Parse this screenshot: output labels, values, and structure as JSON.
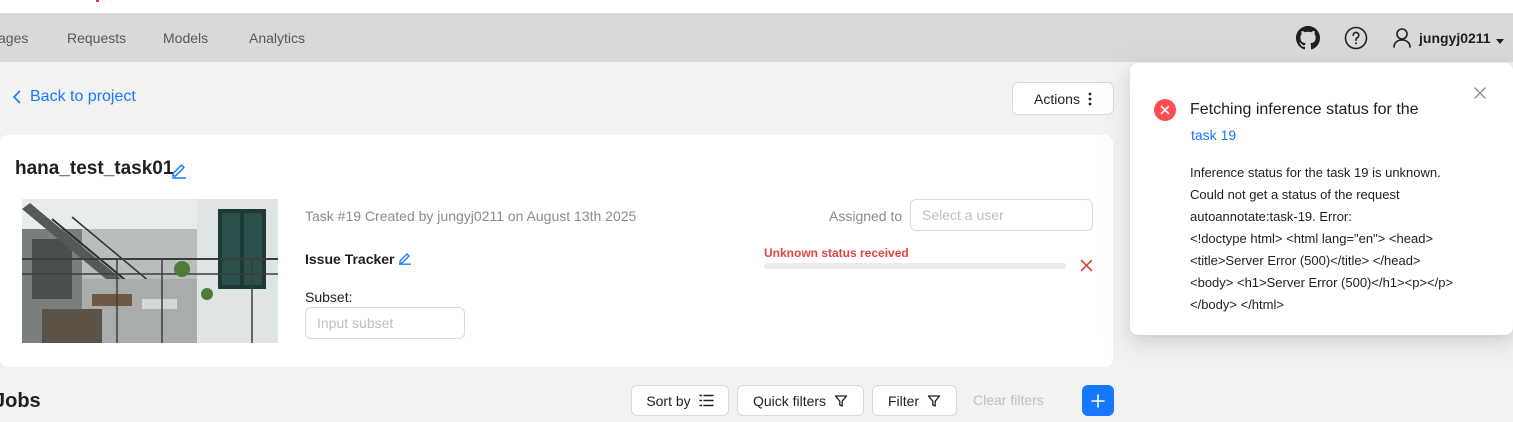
{
  "nav": {
    "items": [
      "ages",
      "Requests",
      "Models",
      "Analytics"
    ],
    "user": "jungyj0211",
    "icons": [
      "github-icon",
      "help-icon",
      "user-icon",
      "caret-down-icon"
    ]
  },
  "page": {
    "back_label": "Back to project",
    "actions_label": "Actions"
  },
  "task": {
    "title": "hana_test_task01",
    "meta": "Task #19 Created by jungyj0211 on August 13th 2025",
    "assigned_label": "Assigned to",
    "assign_placeholder": "Select a user",
    "issue_tracker_label": "Issue Tracker",
    "subset_label": "Subset:",
    "subset_placeholder": "Input subset",
    "status_text": "Unknown status received",
    "progress": 0
  },
  "jobs": {
    "title": "Jobs",
    "sort_label": "Sort by",
    "quick_filters_label": "Quick filters",
    "filter_label": "Filter",
    "clear_filters_label": "Clear filters"
  },
  "notification": {
    "title": "Fetching inference status for the",
    "link": "task 19",
    "body_lines": [
      "Inference status for the task 19 is unknown.",
      "Could not get a status of the request",
      "autoannotate:task-19. Error:",
      "<!doctype html> <html lang=\"en\"> <head>",
      "<title>Server Error (500)</title> </head>",
      "<body> <h1>Server Error (500)</h1><p></p>",
      "</body> </html>"
    ]
  },
  "colors": {
    "accent": "#1677ff",
    "error": "#ff4d4f",
    "status_error_text": "#e04545",
    "navbar_bg": "#d9d9d9",
    "page_bg": "#f2f2f2"
  }
}
